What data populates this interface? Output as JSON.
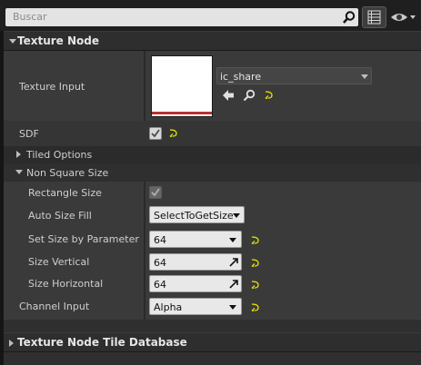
{
  "search": {
    "placeholder": "Buscar"
  },
  "sections": {
    "texture_node": "Texture Node",
    "tile_database": "Texture Node Tile Database"
  },
  "texture_input": {
    "label": "Texture Input",
    "asset_name": "ic_share"
  },
  "sdf": {
    "label": "SDF",
    "checked": true
  },
  "tiled_options": {
    "label": "Tiled Options"
  },
  "non_square": {
    "label": "Non Square Size",
    "rectangle_size": {
      "label": "Rectangle Size",
      "checked": true
    },
    "auto_size_fill": {
      "label": "Auto Size Fill",
      "value": "SelectToGetSize"
    },
    "set_size_by_param": {
      "label": "Set Size by Parameter",
      "value": "64"
    },
    "size_vertical": {
      "label": "Size Vertical",
      "value": "64"
    },
    "size_horizontal": {
      "label": "Size Horizontal",
      "value": "64"
    }
  },
  "channel_input": {
    "label": "Channel Input",
    "value": "Alpha"
  },
  "icons": [
    "search-icon",
    "grid-view-icon",
    "eye-icon",
    "chevron-down-icon",
    "arrow-left-icon",
    "magnifier-icon",
    "reset-arrow-icon",
    "checkmark-icon",
    "pick-arrow-icon"
  ],
  "colors": {
    "reset_arrow": "#e6e600",
    "texture_underline": "#b83232"
  }
}
